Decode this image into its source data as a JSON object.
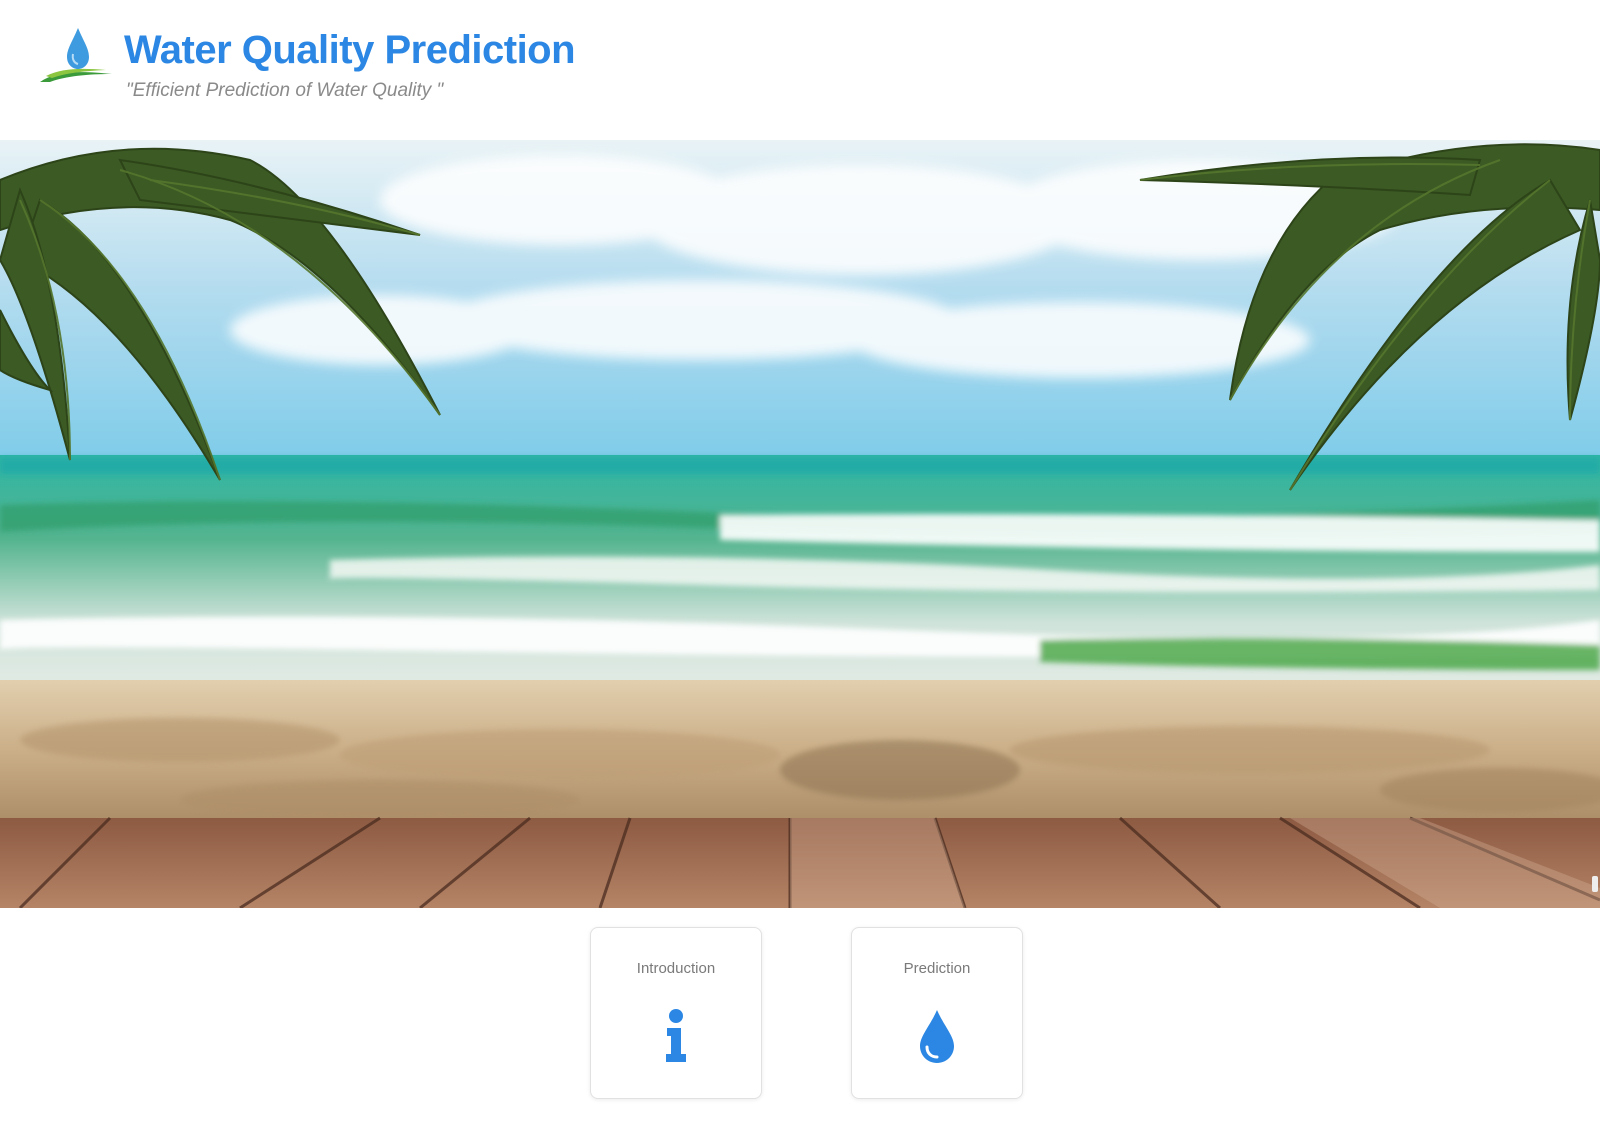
{
  "header": {
    "title": "Water Quality Prediction",
    "tagline": "\"Efficient Prediction of Water Quality \"",
    "logo_icon": "water-drop-logo"
  },
  "hero": {
    "image": "beach-scene-palms-sea-sand-deck"
  },
  "nav_cards": [
    {
      "label": "Introduction",
      "icon": "info-icon"
    },
    {
      "label": "Prediction",
      "icon": "water-drop-icon"
    }
  ],
  "colors": {
    "accent": "#2b87e3",
    "tagline": "#8a8a8a",
    "card_label": "#7a7a7a",
    "card_border": "#e1e1e1"
  }
}
